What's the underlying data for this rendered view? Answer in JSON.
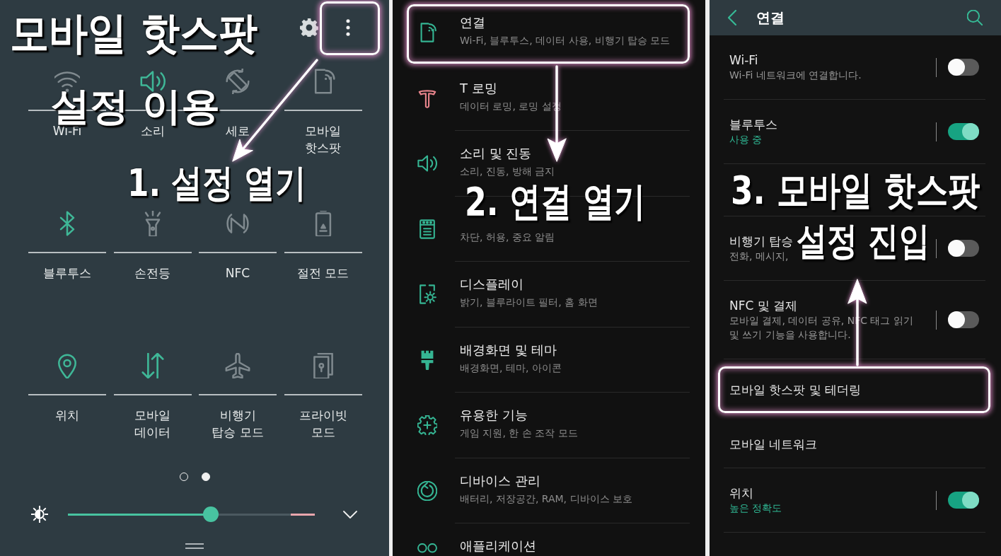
{
  "quick_panel": {
    "caption": [
      "모바일 핫스팟",
      "설정 이용"
    ],
    "more_button": {
      "highlighted": true
    },
    "tiles": [
      {
        "label": "Wi-Fi",
        "on": false
      },
      {
        "label": "소리",
        "on": true
      },
      {
        "label": "세로",
        "on": false
      },
      {
        "label": "모바일\n핫스팟",
        "on": false
      },
      {
        "label": "블루투스",
        "on": true
      },
      {
        "label": "손전등",
        "on": false
      },
      {
        "label": "NFC",
        "on": false
      },
      {
        "label": "절전 모드",
        "on": false
      },
      {
        "label": "위치",
        "on": true
      },
      {
        "label": "모바일\n데이터",
        "on": true
      },
      {
        "label": "비행기\n탑승 모드",
        "on": false
      },
      {
        "label": "프라이빗\n모드",
        "on": false
      }
    ],
    "step_caption": "1. 설정 열기",
    "pages": [
      {
        "selected": false
      },
      {
        "selected": true
      }
    ],
    "brightness": {
      "level": 0.58
    }
  },
  "settings": {
    "items": [
      {
        "title": "연결",
        "subtitle": "Wi-Fi, 블루투스, 데이터 사용, 비행기 탑승 모드",
        "highlighted": true
      },
      {
        "title": "T 로밍",
        "subtitle": "데이터 로밍, 로밍 설정",
        "highlighted": false
      },
      {
        "title": "소리 및 진동",
        "subtitle": "소리, 진동, 방해 금지",
        "highlighted": false
      },
      {
        "subtitle": "차단, 허용, 중요 알림",
        "highlighted": false
      },
      {
        "title": "디스플레이",
        "subtitle": "밝기, 블루라이트 필터, 홈 화면",
        "highlighted": false
      },
      {
        "title": "배경화면 및 테마",
        "subtitle": "배경화면, 테마, 아이콘",
        "highlighted": false
      },
      {
        "title": "유용한 기능",
        "subtitle": "게임 지원, 한 손 조작 모드",
        "highlighted": false
      },
      {
        "title": "디바이스 관리",
        "subtitle": "배터리, 저장공간, RAM, 디바이스 보호",
        "highlighted": false
      },
      {
        "title": "애플리케이션",
        "highlighted": false
      }
    ],
    "step_caption": "2. 연결 열기"
  },
  "connections": {
    "title": "연결",
    "items": [
      {
        "kind": "toggle",
        "title": "Wi-Fi",
        "subtitle": "Wi-Fi 네트워크에 연결합니다.",
        "on": false,
        "highlighted": false
      },
      {
        "kind": "toggle",
        "title": "블루투스",
        "subtitle": "사용 중",
        "on": true,
        "highlighted": false
      },
      {
        "kind": "caption",
        "lines": [
          "3. 모바일 핫스팟",
          "설정 진입"
        ]
      },
      {
        "kind": "toggle",
        "title": "비행기 탑승",
        "subtitle": "전화, 메시지,",
        "on": false,
        "highlighted": false
      },
      {
        "kind": "toggle",
        "title": "NFC 및 결제",
        "subtitle": "모바일 결제, 데이터 공유, NFC 태그 읽기 및 쓰기 기능을 사용합니다.",
        "on": false,
        "highlighted": false
      },
      {
        "kind": "plain",
        "title": "모바일 핫스팟 및 테더링",
        "highlighted": true
      },
      {
        "kind": "plain",
        "title": "모바일 네트워크",
        "highlighted": false
      },
      {
        "kind": "toggle",
        "title": "위치",
        "subtitle": "높은 정확도",
        "on": true,
        "highlighted": false
      }
    ]
  }
}
